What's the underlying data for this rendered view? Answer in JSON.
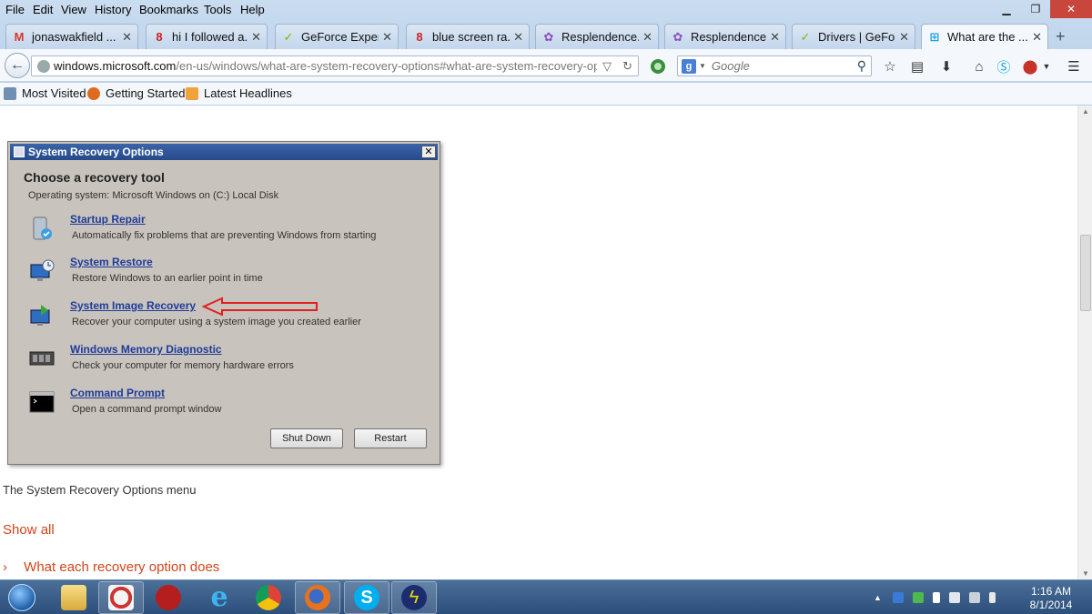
{
  "menu": [
    "File",
    "Edit",
    "View",
    "History",
    "Bookmarks",
    "Tools",
    "Help"
  ],
  "tabs": [
    {
      "label": "jonaswakfield ...",
      "icon": "gmail-icon",
      "color": "#d9362b"
    },
    {
      "label": "hi I followed a...",
      "icon": "community-icon",
      "color": "#cc2222"
    },
    {
      "label": "GeForce Exper...",
      "icon": "geforce-icon",
      "color": "#76b900"
    },
    {
      "label": "blue screen ra...",
      "icon": "community-icon",
      "color": "#cc2222"
    },
    {
      "label": "Resplendence...",
      "icon": "resplendence-icon",
      "color": "#8a4fbf"
    },
    {
      "label": "Resplendence...",
      "icon": "resplendence-icon",
      "color": "#8a4fbf"
    },
    {
      "label": "Drivers | GeFo...",
      "icon": "geforce-icon",
      "color": "#76b900"
    },
    {
      "label": "What are the ...",
      "icon": "windows-icon",
      "color": "#1ba1e2"
    }
  ],
  "url": {
    "host": "windows.microsoft.com",
    "path": "/en-us/windows/what-are-system-recovery-options#what-are-system-recovery-options=wi"
  },
  "search": {
    "placeholder": "Google"
  },
  "bookmarks": [
    "Most Visited",
    "Getting Started",
    "Latest Headlines"
  ],
  "dialog": {
    "title": "System Recovery Options",
    "heading": "Choose a recovery tool",
    "os_line": "Operating system: Microsoft Windows on (C:) Local Disk",
    "tools": [
      {
        "name": "Startup Repair",
        "desc": "Automatically fix problems that are preventing Windows from starting"
      },
      {
        "name": "System Restore",
        "desc": "Restore Windows to an earlier point in time"
      },
      {
        "name": "System Image Recovery",
        "desc": "Recover your computer using a system image you created earlier"
      },
      {
        "name": "Windows Memory Diagnostic",
        "desc": "Check your computer for memory hardware errors"
      },
      {
        "name": "Command Prompt",
        "desc": "Open a command prompt window"
      }
    ],
    "buttons": {
      "shutdown": "Shut Down",
      "restart": "Restart"
    }
  },
  "caption": "The System Recovery Options menu",
  "show_all": "Show all",
  "section": {
    "chevron": "›",
    "title": "What each recovery option does"
  },
  "clock": {
    "time": "1:16 AM",
    "date": "8/1/2014"
  },
  "colors": {
    "accent_link": "#d0451b",
    "dialog_link": "#1f3c9a",
    "taskbar": "#2c4f7b"
  }
}
